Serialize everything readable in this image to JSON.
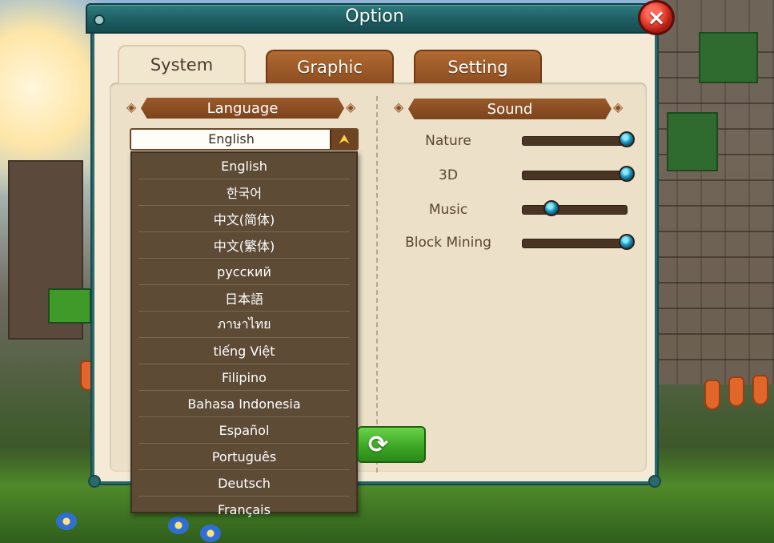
{
  "window": {
    "title": "Option",
    "close_icon": "×"
  },
  "tabs": [
    {
      "label": "System",
      "active": true
    },
    {
      "label": "Graphic",
      "active": false
    },
    {
      "label": "Setting",
      "active": false
    }
  ],
  "language": {
    "header": "Language",
    "selected": "English",
    "arrow_icon": "⮝",
    "options": [
      "English",
      "한국어",
      "中文(简体)",
      "中文(繁体)",
      "русский",
      "日本語",
      "ภาษาไทย",
      "tiếng Việt",
      "Filipino",
      "Bahasa Indonesia",
      "Español",
      "Português",
      "Deutsch",
      "Français"
    ]
  },
  "sound": {
    "header": "Sound",
    "sliders": [
      {
        "label": "Nature",
        "level": 1.0
      },
      {
        "label": "3D",
        "level": 1.0
      },
      {
        "label": "Music",
        "level": 0.28
      },
      {
        "label": "Block Mining",
        "level": 1.0
      }
    ]
  },
  "reset_icon": "⟳"
}
